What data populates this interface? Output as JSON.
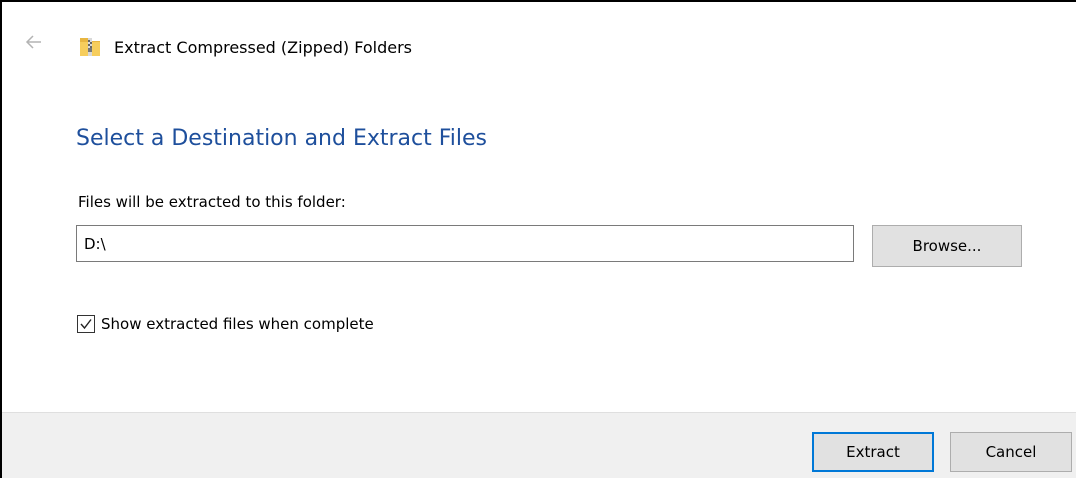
{
  "window": {
    "title": "Extract Compressed (Zipped) Folders",
    "back_icon": "back-arrow-icon",
    "title_icon": "zip-folder-icon"
  },
  "main": {
    "heading": "Select a Destination and Extract Files",
    "destination_label": "Files will be extracted to this folder:",
    "destination_value": "D:\\",
    "browse_label": "Browse...",
    "show_files_label": "Show extracted files when complete",
    "show_files_checked": true
  },
  "footer": {
    "extract_label": "Extract",
    "cancel_label": "Cancel"
  },
  "colors": {
    "heading": "#1e4f9c",
    "default_button_border": "#0078d7",
    "footer_background": "#f0f0f0",
    "button_background": "#e1e1e1"
  }
}
